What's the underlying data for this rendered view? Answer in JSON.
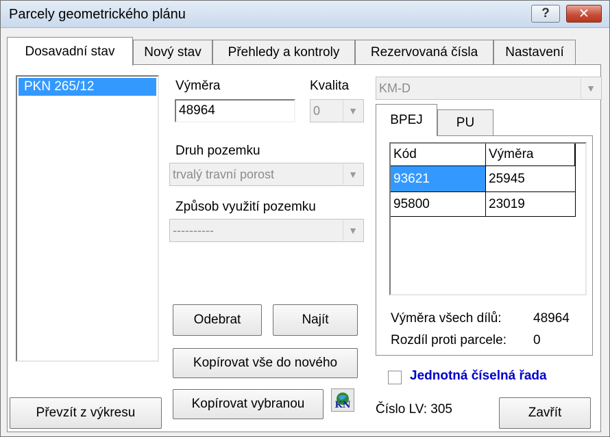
{
  "window": {
    "title": "Parcely geometrického plánu",
    "help_glyph": "?",
    "close_glyph": "✕"
  },
  "tabs": [
    {
      "label": "Dosavadní stav",
      "active": true
    },
    {
      "label": "Nový stav"
    },
    {
      "label": "Přehledy a kontroly"
    },
    {
      "label": "Rezervovaná čísla"
    },
    {
      "label": "Nastavení"
    }
  ],
  "parcel_list": {
    "items": [
      "PKN 265/12"
    ],
    "selected": "PKN 265/12"
  },
  "form": {
    "vymera_label": "Výměra",
    "vymera_value": "48964",
    "kvalita_label": "Kvalita",
    "kvalita_value": "0",
    "druh_label": "Druh pozemku",
    "druh_value": "trvalý travní porost",
    "zpusob_label": "Způsob využití pozemku",
    "zpusob_value": "----------",
    "map_combo_value": "KM-D"
  },
  "inner_tabs": [
    {
      "label": "BPEJ",
      "active": true
    },
    {
      "label": "PU"
    }
  ],
  "bpej_grid": {
    "columns": [
      "Kód",
      "Výměra"
    ],
    "rows": [
      {
        "kod": "93621",
        "vymera": "25945",
        "selected": true
      },
      {
        "kod": "95800",
        "vymera": "23019"
      }
    ]
  },
  "summary": {
    "vymera_vsech_label": "Výměra všech dílů:",
    "vymera_vsech_value": "48964",
    "rozdil_label": "Rozdíl proti parcele:",
    "rozdil_value": "0"
  },
  "checkbox": {
    "label": "Jednotná číselná řada",
    "checked": false,
    "color": "#0000cc"
  },
  "buttons": {
    "odebrat": "Odebrat",
    "najit": "Najít",
    "kopirovat_vse": "Kopírovat vše do nového",
    "prevzit": "Převzít z výkresu",
    "kopirovat_vybranou": "Kopírovat vybranou",
    "kn_icon_text": "KN",
    "zavrit": "Zavřít"
  },
  "status": {
    "cislo_lv": "Číslo LV: 305"
  },
  "colors": {
    "selection": "#3399ff",
    "close_button": "#c34a35"
  }
}
